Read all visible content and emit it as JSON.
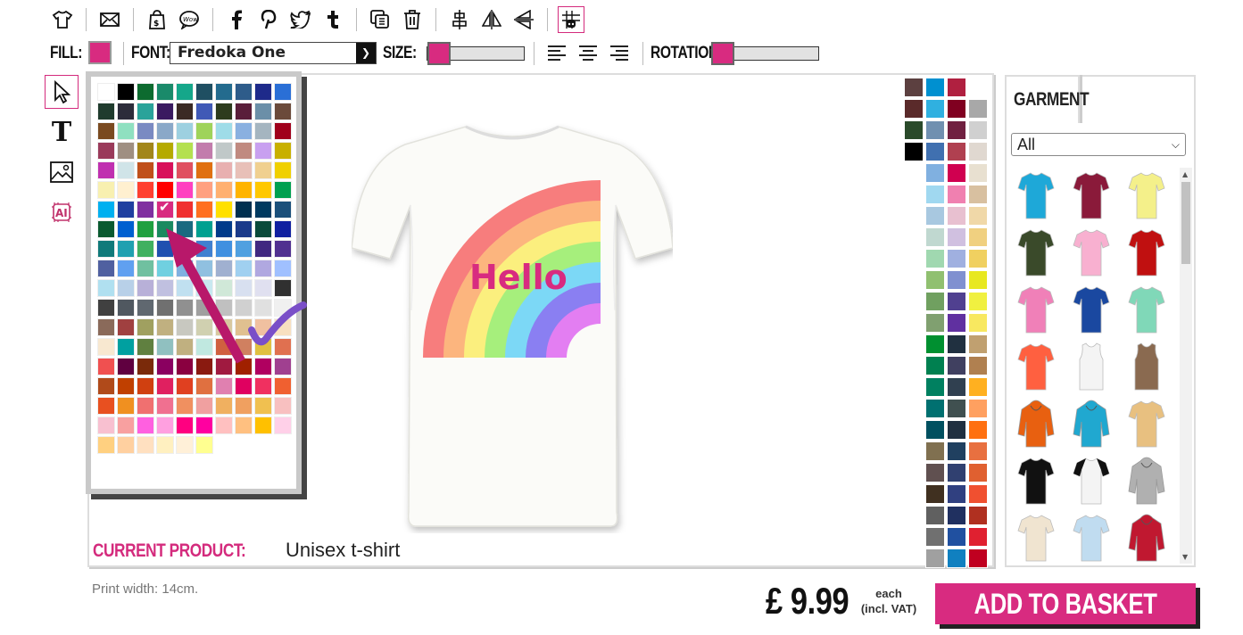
{
  "toolbar": {
    "icons": [
      "tshirt-icon",
      "envelope-icon",
      "shopping-bag-icon",
      "speech-bubble-icon",
      "facebook-icon",
      "pinterest-icon",
      "twitter-icon",
      "tumblr-icon",
      "duplicate-icon",
      "trash-icon",
      "align-center-icon",
      "flip-horizontal-icon",
      "flip-vertical-icon",
      "grid-snap-icon"
    ]
  },
  "options": {
    "fill_label": "FILL:",
    "fill_color": "#d82b80",
    "font_label": "FONT:",
    "font_value": "Fredoka One",
    "size_label": "SIZE:",
    "rotation_label": "ROTATION:"
  },
  "palette": {
    "selected_index": 63,
    "colors": [
      "#ffffff",
      "#000000",
      "#0d6b2f",
      "#1a8a6a",
      "#15a78a",
      "#1f4f62",
      "#236b8e",
      "#2e5c8a",
      "#1e2a8a",
      "#2a6fd6",
      "#1f3b2d",
      "#2c2c3a",
      "#2aa39a",
      "#3a1a60",
      "#3b2a24",
      "#4059b6",
      "#2d3b1d",
      "#5a1e3a",
      "#6b8fa8",
      "#6b4a3a",
      "#7a4a20",
      "#8fe0c0",
      "#7a8ac2",
      "#8aa8c8",
      "#9dd0e0",
      "#9fd35a",
      "#9fdce8",
      "#8ab0e0",
      "#a5b5c0",
      "#a0001b",
      "#9a3a5a",
      "#9f8f82",
      "#a2861a",
      "#b5aa00",
      "#b4e050",
      "#c27cac",
      "#c0c8c8",
      "#c08a80",
      "#c8a0f0",
      "#c8b000",
      "#c030b0",
      "#d0e4e8",
      "#c0501a",
      "#d8105a",
      "#e05060",
      "#e07010",
      "#e8b0b0",
      "#e8c0b8",
      "#f0d090",
      "#f0d000",
      "#f8f0b0",
      "#fff0d0",
      "#ff4030",
      "#ff0000",
      "#ff40c0",
      "#ffa080",
      "#ffb070",
      "#ffb400",
      "#ffc800",
      "#00a050",
      "#00b0f0",
      "#2040a0",
      "#8030a0",
      "#d82b80",
      "#f03030",
      "#ff7020",
      "#ffe000",
      "#003050",
      "#003a60",
      "#1a4f7a",
      "#0a5a30",
      "#0060d0",
      "#20a040",
      "#1a8a60",
      "#1a6a80",
      "#00a090",
      "#003a8a",
      "#1a3a8a",
      "#0a4a3a",
      "#1020a0",
      "#107a7a",
      "#20a0b0",
      "#40b060",
      "#2050b0",
      "#3070c0",
      "#4080d0",
      "#4090e0",
      "#50a0e0",
      "#402880",
      "#503090",
      "#5060a0",
      "#60a0f0",
      "#70c0a0",
      "#70d0e0",
      "#80b0e0",
      "#90c0e0",
      "#a0b0d0",
      "#a0d0f0",
      "#b0a8e0",
      "#a0c0ff",
      "#b0e0f0",
      "#b8d0e8",
      "#b8b0d8",
      "#c0c0e0",
      "#c0e0f0",
      "#c8e8f0",
      "#d0e8d8",
      "#d8e0f0",
      "#e0e0f0",
      "#303030",
      "#404040",
      "#505860",
      "#606870",
      "#707070",
      "#909090",
      "#a0a0a0",
      "#c0c0c0",
      "#d0d0d0",
      "#e0e0e0",
      "#f0f0f0",
      "#8a6a5a",
      "#a04040",
      "#a0a060",
      "#c0b080",
      "#c8c8c0",
      "#d0d0b0",
      "#d8c8a0",
      "#e0c090",
      "#f0c0a0",
      "#f8e0c0",
      "#f8e8d0",
      "#00a0a0",
      "#608040",
      "#90c0c0",
      "#c0b080",
      "#c0e8e0",
      "#d06040",
      "#d08060",
      "#e0c040",
      "#e07050",
      "#f05050",
      "#600040",
      "#7a2a0a",
      "#8a0060",
      "#8a0040",
      "#8a1a10",
      "#a01a40",
      "#a02000",
      "#b00060",
      "#a04090",
      "#b04a1a",
      "#c04000",
      "#d04010",
      "#e02060",
      "#e04020",
      "#e07040",
      "#e080b0",
      "#e00060",
      "#f03060",
      "#f06030",
      "#e85020",
      "#f09020",
      "#f07070",
      "#f07090",
      "#f09060",
      "#f0a0a0",
      "#f0b060",
      "#f0a060",
      "#f0c050",
      "#f8c0c0",
      "#f8c0d0",
      "#f8a0a0",
      "#ff60e0",
      "#ffa0e0",
      "#ff0080",
      "#ff00a0",
      "#ffc0c0",
      "#ffc080",
      "#ffc000",
      "#ffd0e8",
      "#ffd080",
      "#ffd0a0",
      "#ffe0c0",
      "#fff0c0",
      "#fff0d8",
      "#ffff90"
    ]
  },
  "side_swatches": [
    "#5c4040",
    "#0090d0",
    "#b02040",
    "#ffffff",
    "#5a2a2a",
    "#30b0e0",
    "#800020",
    "#a8a8a8",
    "#2a4a2a",
    "#7090b0",
    "#702040",
    "#d0d0d0",
    "#000000",
    "#4070b0",
    "#b04050",
    "#e0d8d0",
    "#80b0e0",
    "#d00050",
    "#e8e0d0",
    "#a0d8f0",
    "#f080b0",
    "#d8c0a0",
    "#a8c8e0",
    "#e8c0d0",
    "#f0d8a8",
    "#c0d8d0",
    "#d0c0e0",
    "#f0d080",
    "#a0d8b0",
    "#a0b0e0",
    "#f0d060",
    "#90c070",
    "#8090d0",
    "#e8e820",
    "#70a060",
    "#504090",
    "#f0f040",
    "#80a070",
    "#6030a0",
    "#f8e860",
    "#009030",
    "#203040",
    "#c0a070",
    "#008050",
    "#404060",
    "#b08050",
    "#008060",
    "#304050",
    "#ffb020",
    "#007070",
    "#405050",
    "#ffa060",
    "#005060",
    "#203040",
    "#ff7010",
    "#807050",
    "#204060",
    "#e87040",
    "#605050",
    "#304070",
    "#e06030",
    "#403020",
    "#304080",
    "#f05030",
    "#606060",
    "#203060",
    "#b03020",
    "#707070",
    "#2050a0",
    "#e02030",
    "#a0a0a0",
    "#1080c0",
    "#c00020"
  ],
  "product": {
    "design_text": "Hello",
    "current_label": "CURRENT PRODUCT:",
    "current_value": "Unisex t-shirt"
  },
  "garment": {
    "tab_label": "GARMENT",
    "filter_value": "All",
    "items": [
      {
        "name": "tee-sky",
        "color": "#1ea8d8"
      },
      {
        "name": "tee-burgundy",
        "color": "#8a1a3a"
      },
      {
        "name": "tee-yellow",
        "color": "#f4f08a"
      },
      {
        "name": "tee-olive",
        "color": "#3a4a2a"
      },
      {
        "name": "tee-pink",
        "color": "#f8b0d0"
      },
      {
        "name": "tee-red",
        "color": "#c01010"
      },
      {
        "name": "tee-hot-pink",
        "color": "#f080b8"
      },
      {
        "name": "tee-royal",
        "color": "#1a48a0"
      },
      {
        "name": "tee-mint",
        "color": "#80d8b8"
      },
      {
        "name": "tee-coral",
        "color": "#ff6040"
      },
      {
        "name": "tank-white",
        "color": "#f4f4f4"
      },
      {
        "name": "tank-brown",
        "color": "#8a6a50"
      },
      {
        "name": "hoodie-orange",
        "color": "#e86010"
      },
      {
        "name": "hoodie-turquoise",
        "color": "#20a8d0"
      },
      {
        "name": "tee-tiedye",
        "color": "#e8c080"
      },
      {
        "name": "tee-black",
        "color": "#111111"
      },
      {
        "name": "raglan-black-white",
        "color": "#f4f4f4"
      },
      {
        "name": "hoodie-grey",
        "color": "#b0b0b0"
      },
      {
        "name": "tee-natural",
        "color": "#f0e4d0"
      },
      {
        "name": "tee-dip-dye",
        "color": "#c0dcf0"
      },
      {
        "name": "varsity-red",
        "color": "#c01830"
      }
    ]
  },
  "footer": {
    "print_width": "Print width: 14cm.",
    "price": "£ 9.99",
    "each_line1": "each",
    "each_line2": "(incl. VAT)",
    "add_to_basket": "ADD TO BASKET"
  },
  "colors": {
    "accent": "#d82b80"
  }
}
